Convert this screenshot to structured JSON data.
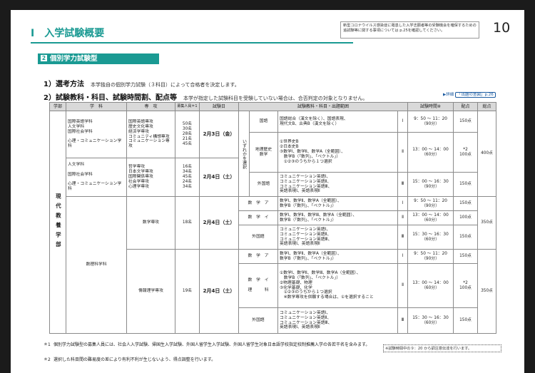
{
  "header": {
    "section": "Ⅰ　入学試験概要",
    "note": "新型コロナウイルス感染症に罹患した入学志願者等の受験機会を確保するための追試験等に関する事項については p.25を確認してください。",
    "page_number": "10"
  },
  "section": {
    "num": "2",
    "title": "個別学力試験型"
  },
  "items": {
    "method_label": "1）選考方法",
    "method_text": "本学独自の個別学力試験（３科目）によって合格者を決定します。",
    "subjects_label": "2）試験教科・科目、試験時間割、配点等",
    "subjects_text": "本学が指定した試験科目を受験していない場合は、合否判定の対象となりません。",
    "detail_link": "▶詳細",
    "detail_badge": "「出題の意図」p.26"
  },
  "table": {
    "headers": {
      "faculty": "学部",
      "dept": "学　科",
      "major": "専　攻",
      "quota": "募集人員＊1",
      "date": "試験日",
      "subject_header": "試験教科・科目・出題範囲",
      "time": "試験時間※",
      "score": "配点",
      "total": "総点"
    },
    "faculty": "現代教養学部",
    "dept_group1": "国際英語学科\n人文学科\n国際社会学科\n\n心理・コミュニケーション学科",
    "majors_g1": "国際英語専攻\n歴史文化専攻\n経済学専攻\nコミュニティ構想専攻\nコミュニケーション専攻",
    "quota_g1": "50名\n30名\n28名\n21名\n45名",
    "dept_group2": "人文学科\n\n国際社会学科\n\n心理・コミュニケーション学科",
    "majors_g2": "哲学専攻\n日本文学専攻\n国際関係専攻\n社会学専攻\n心理学専攻",
    "quota_g2": "16名\n34名\n45名\n24名\n34名",
    "date1": "2月3日（金）",
    "date2": "2月4日（土）",
    "date3": "2月4日（土）",
    "date4": "2月4日（土）",
    "either_label": "いずれかを選択",
    "kokugo": "国語",
    "kokugo_range": "国語総合（漢文を除く）、国語表現、\n現代文B、古典B（漢文を除く）",
    "chireki_label": "地理歴史\n数学",
    "chireki_range": "①世界史B\n②日本史B\n③数学Ⅰ、数学Ⅱ、数学A（全範囲）、\n　数学B（「数列」、「ベクトル」）\n　①②③のうちから１つ選択",
    "gaikoku": "外国語",
    "eigo_range": "コミュニケーション英語Ⅰ、\nコミュニケーション英語Ⅱ、\nコミュニケーション英語Ⅲ、\n英語表現Ⅰ、英語表現Ⅱ",
    "periods": {
      "p1": "Ⅰ",
      "p2": "Ⅱ",
      "p3": "Ⅲ"
    },
    "time1": "9：50 ～ 11：20\n（90分）",
    "time2": "13：00 ～ 14：00\n（60分）",
    "time3": "15：00 ～ 16：30\n（90分）",
    "time3b": "15：30 ～ 16：30\n（60分）",
    "score150": "150点",
    "score100": "100点",
    "score100_2": "*2\n100点",
    "total400": "400点",
    "total350": "350点",
    "dept_math": "数理科学科",
    "major_math": "数学専攻",
    "quota_math": "18名",
    "major_info": "情報理学専攻",
    "quota_info": "19名",
    "math_a": "数　学　ア",
    "math_a_range": "数学Ⅰ、数学Ⅱ、数学A（全範囲）、\n数学B（「数列」、「ベクトル」）",
    "math_i": "数　学　イ",
    "math_i_range": "数学Ⅰ、数学Ⅱ、数学Ⅲ、数学A（全範囲）、\n数学B（「数列」、「ベクトル」）",
    "math_ri_label": "数　学　イ\n\n理　　　科",
    "math_ri_range": "①数学Ⅰ、数学Ⅱ、数学Ⅲ、数学A（全範囲）、\n　数学B（「数列」、「ベクトル」）\n②物理基礎、物理\n③化学基礎、化学\n　①②③のうちから１つ選択\n　※数学専攻を併願する場合は、①を選択すること"
  },
  "footnotes": {
    "m1": "＊1",
    "f1": "個別学力試験型の募集人員には、社会人入学試験、帰国生入学試験、外国人留学生入学試験、外国人留学生対象日本語学校指定校制推薦入学の各若干名を含みます。",
    "m2": "＊2",
    "f2": "選択した科目間の難易度の差により有利不利が生じないよう、得点調整を行います。",
    "box": "※試験時間中の９：20 から調注意伝達を行います。"
  }
}
